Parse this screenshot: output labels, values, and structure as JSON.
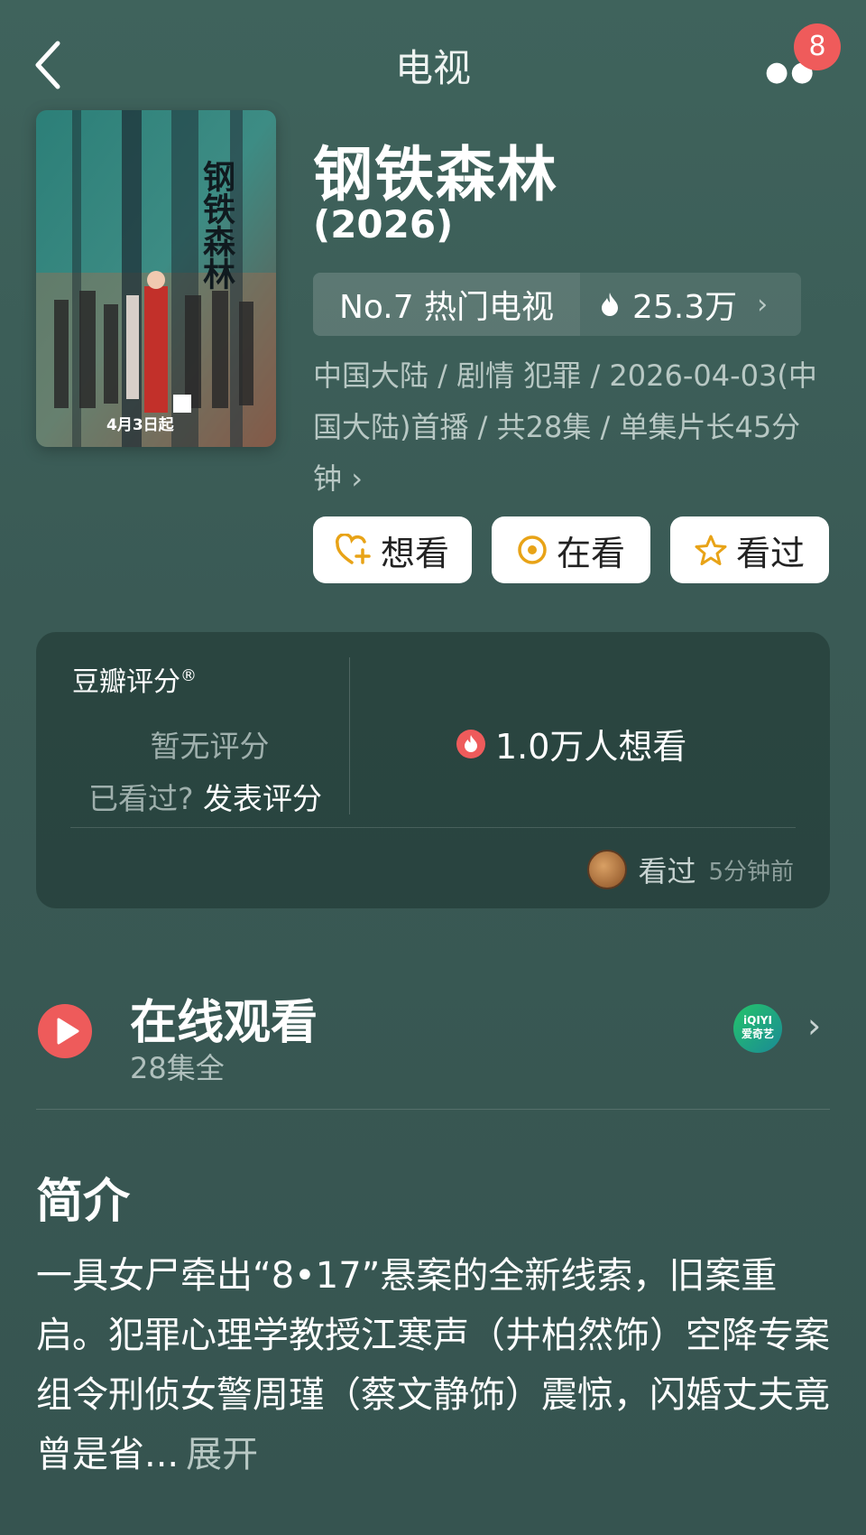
{
  "header": {
    "title": "电视",
    "more_icon": "more-dots-icon",
    "notification_count": "8"
  },
  "movie": {
    "title": "钢铁森林",
    "year": "(2026)",
    "poster_date": "4月3日起",
    "rank_label": "No.7 热门电视",
    "heat": "25.3万",
    "meta": "中国大陆 / 剧情 犯罪 / 2026-04-03(中国大陆)首播 / 共28集 / 单集片长45分钟",
    "meta_chevron": "›"
  },
  "actions": [
    {
      "label": "想看",
      "icon": "heart-plus-icon"
    },
    {
      "label": "在看",
      "icon": "target-icon"
    },
    {
      "label": "看过",
      "icon": "star-icon"
    }
  ],
  "rating": {
    "label": "豆瓣评分",
    "reg": "®",
    "no_rating": "暂无评分",
    "prompt": "已看过?",
    "prompt_link": "发表评分",
    "want_count": "1.0万人想看",
    "recent_action": "看过",
    "recent_time": "5分钟前"
  },
  "online": {
    "title": "在线观看",
    "subtitle": "28集全",
    "platform_line1": "iQIYI",
    "platform_line2": "爱奇艺"
  },
  "intro": {
    "heading": "简介",
    "text": "一具女尸牵出“8•17”悬案的全新线索，旧案重启。犯罪心理学教授江寒声（井柏然饰）空降专案组令刑侦女警周瑾（蔡文静饰）震惊，闪婚丈夫竟曾是省...",
    "expand": "展开"
  },
  "colors": {
    "accent_red": "#ee5b5b",
    "action_icon": "#e8a317",
    "background": "#3f635c"
  }
}
